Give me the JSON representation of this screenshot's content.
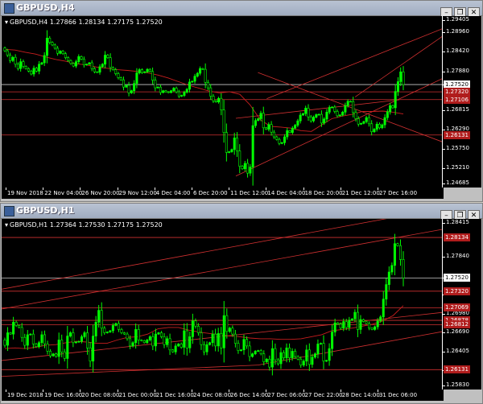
{
  "colors": {
    "background": "#000000",
    "bull_candle": "#00ff00",
    "bear_candle": "#00ff00",
    "hline_white": "#c8c8c8",
    "hline_red": "#d03030",
    "moving_average": "#c81e1e",
    "channel": "#d03030",
    "price_label_red": "#b01c1c"
  },
  "windows": [
    {
      "title": "GBPUSD,H4",
      "info": "GBPUSD,H4  1.27866 1.28134 1.27175 1.27520",
      "chart_data": {
        "type": "candlestick",
        "symbol": "GBPUSD",
        "timeframe": "H4",
        "ohlc_last": {
          "open": 1.27866,
          "high": 1.28134,
          "low": 1.27175,
          "close": 1.2752
        },
        "ylim": [
          1.24685,
          1.29405
        ],
        "price_ticks": [
          "1.29405",
          "1.28960",
          "1.28420",
          "1.27880",
          "1.27520",
          "1.26815",
          "1.26290",
          "1.25750",
          "1.25210",
          "1.24685"
        ],
        "price_labels": [
          {
            "text": "1.27520",
            "value": 1.2752,
            "style": "white"
          },
          {
            "text": "1.27320",
            "value": 1.2732,
            "style": "red"
          },
          {
            "text": "1.27106",
            "value": 1.27106,
            "style": "red"
          },
          {
            "text": "1.26131",
            "value": 1.26131,
            "style": "red"
          }
        ],
        "time_labels": [
          "19 Nov 2018",
          "22 Nov 04:00",
          "26 Nov 20:00",
          "29 Nov 12:00",
          "4 Dec 04:00",
          "6 Dec 20:00",
          "11 Dec 12:00",
          "14 Dec 04:00",
          "18 Dec 20:00",
          "21 Dec 12:00",
          "27 Dec 16:00"
        ],
        "closes": [
          1.2845,
          1.2833,
          1.2818,
          1.2827,
          1.2808,
          1.2796,
          1.2815,
          1.2802,
          1.2796,
          1.2789,
          1.2781,
          1.2797,
          1.2789,
          1.2808,
          1.2812,
          1.2832,
          1.288,
          1.2868,
          1.2861,
          1.2852,
          1.2838,
          1.2844,
          1.2837,
          1.2826,
          1.2818,
          1.281,
          1.2803,
          1.2815,
          1.2829,
          1.2822,
          1.2806,
          1.2808,
          1.2812,
          1.2796,
          1.2787,
          1.2786,
          1.2801,
          1.2808,
          1.2833,
          1.2826,
          1.2799,
          1.2793,
          1.2782,
          1.2771,
          1.2765,
          1.2745,
          1.275,
          1.2729,
          1.2735,
          1.2755,
          1.2784,
          1.2793,
          1.2785,
          1.2787,
          1.2794,
          1.2788,
          1.2764,
          1.2743,
          1.2745,
          1.273,
          1.2735,
          1.2732,
          1.273,
          1.2735,
          1.2742,
          1.2732,
          1.272,
          1.2722,
          1.2731,
          1.2739,
          1.2759,
          1.2761,
          1.2775,
          1.2783,
          1.2796,
          1.2794,
          1.2758,
          1.2743,
          1.272,
          1.2707,
          1.2704,
          1.2714,
          1.2682,
          1.262,
          1.2565,
          1.2567,
          1.2573,
          1.2605,
          1.2569,
          1.2527,
          1.252,
          1.2535,
          1.2508,
          1.2525,
          1.2639,
          1.2653,
          1.2658,
          1.2673,
          1.2633,
          1.2629,
          1.2642,
          1.2621,
          1.2608,
          1.2601,
          1.259,
          1.2592,
          1.2608,
          1.2625,
          1.262,
          1.2632,
          1.264,
          1.2652,
          1.2668,
          1.2672,
          1.2687,
          1.2663,
          1.2652,
          1.2662,
          1.2669,
          1.267,
          1.2646,
          1.2657,
          1.2676,
          1.2689,
          1.269,
          1.2678,
          1.2666,
          1.2668,
          1.2676,
          1.2694,
          1.2706,
          1.2705,
          1.2675,
          1.2658,
          1.2643,
          1.2645,
          1.265,
          1.2661,
          1.2644,
          1.2622,
          1.2629,
          1.2643,
          1.2633,
          1.2641,
          1.2661,
          1.2677,
          1.2694,
          1.2688,
          1.2733,
          1.276,
          1.2787,
          1.2752
        ]
      },
      "ma_points": [
        1.2849,
        1.2847,
        1.2841,
        1.2836,
        1.2828,
        1.2821,
        1.2816,
        1.2809,
        1.2806,
        1.28,
        1.2797,
        1.2793,
        1.2791,
        1.2788,
        1.2784,
        1.2778,
        1.277,
        1.276,
        1.275,
        1.2742,
        1.2734,
        1.2729,
        1.2732,
        1.2725,
        1.2696,
        1.2655,
        1.2637,
        1.2635,
        1.2632,
        1.2625,
        1.2623,
        1.2641,
        1.2658,
        1.2665,
        1.267,
        1.2678,
        1.2678,
        1.2679,
        1.2676,
        1.2671
      ],
      "trend_lines": [
        {
          "x1": 0.53,
          "y1": 1.2659,
          "x2": 0.9,
          "y2": 1.271
        },
        {
          "x1": 0.53,
          "y1": 1.25,
          "x2": 1.0,
          "y2": 1.277
        },
        {
          "x1": 0.58,
          "y1": 1.2785,
          "x2": 1.0,
          "y2": 1.2593
        },
        {
          "x1": 0.8,
          "y1": 1.2718,
          "x2": 1.0,
          "y2": 1.2887
        },
        {
          "x1": 0.6,
          "y1": 1.2713,
          "x2": 1.0,
          "y2": 1.2907
        }
      ]
    },
    {
      "title": "GBPUSD,H1",
      "info": "GBPUSD,H1  1.27364 1.27530 1.27175 1.27520",
      "chart_data": {
        "type": "candlestick",
        "symbol": "GBPUSD",
        "timeframe": "H1",
        "ohlc_last": {
          "open": 1.27364,
          "high": 1.2753,
          "low": 1.27175,
          "close": 1.2752
        },
        "ylim": [
          1.2583,
          1.28415
        ],
        "price_ticks": [
          "1.28415",
          "1.27840",
          "1.27520",
          "1.27265",
          "1.26980",
          "1.26690",
          "1.26405",
          "1.26120",
          "1.25830"
        ],
        "price_labels": [
          {
            "text": "1.28134",
            "value": 1.28134,
            "style": "red"
          },
          {
            "text": "1.27520",
            "value": 1.2752,
            "style": "white"
          },
          {
            "text": "1.27320",
            "value": 1.2732,
            "style": "red"
          },
          {
            "text": "1.27069",
            "value": 1.27069,
            "style": "red"
          },
          {
            "text": "1.26878",
            "value": 1.26878,
            "style": "red"
          },
          {
            "text": "1.26812",
            "value": 1.26812,
            "style": "red"
          },
          {
            "text": "1.26131",
            "value": 1.26131,
            "style": "red"
          }
        ],
        "time_labels": [
          "19 Dec 2018",
          "19 Dec 16:00",
          "20 Dec 08:00",
          "21 Dec 00:00",
          "21 Dec 16:00",
          "24 Dec 08:00",
          "26 Dec 14:00",
          "27 Dec 06:00",
          "27 Dec 22:00",
          "28 Dec 14:00",
          "31 Dec 06:00"
        ],
        "closes": [
          1.265,
          1.2669,
          1.2667,
          1.2685,
          1.268,
          1.2677,
          1.2662,
          1.265,
          1.2666,
          1.2667,
          1.2652,
          1.2648,
          1.2654,
          1.2666,
          1.2652,
          1.2641,
          1.2634,
          1.2637,
          1.2633,
          1.2658,
          1.264,
          1.263,
          1.2664,
          1.2669,
          1.2654,
          1.2655,
          1.2656,
          1.2663,
          1.2669,
          1.2646,
          1.2626,
          1.2664,
          1.2685,
          1.2703,
          1.2676,
          1.2669,
          1.267,
          1.2672,
          1.268,
          1.2683,
          1.2674,
          1.2669,
          1.2667,
          1.266,
          1.2649,
          1.2654,
          1.2674,
          1.2658,
          1.2657,
          1.2654,
          1.2658,
          1.2663,
          1.2649,
          1.2667,
          1.2669,
          1.2663,
          1.2651,
          1.266,
          1.2643,
          1.264,
          1.2649,
          1.2652,
          1.2647,
          1.2672,
          1.2646,
          1.2663,
          1.2687,
          1.2679,
          1.2669,
          1.2651,
          1.264,
          1.2651,
          1.2654,
          1.2667,
          1.2649,
          1.2668,
          1.2646,
          1.2695,
          1.2671,
          1.2676,
          1.2667,
          1.2653,
          1.2642,
          1.2643,
          1.2659,
          1.2649,
          1.2633,
          1.2637,
          1.2641,
          1.2642,
          1.2637,
          1.2625,
          1.2629,
          1.2617,
          1.2645,
          1.2628,
          1.2622,
          1.2639,
          1.2631,
          1.2646,
          1.2631,
          1.2641,
          1.2633,
          1.2629,
          1.262,
          1.2626,
          1.2643,
          1.2621,
          1.2632,
          1.2637,
          1.2652,
          1.2653,
          1.2626,
          1.2627,
          1.2645,
          1.267,
          1.2684,
          1.2682,
          1.2676,
          1.2686,
          1.2677,
          1.2688,
          1.269,
          1.27,
          1.2674,
          1.2689,
          1.2686,
          1.2683,
          1.2676,
          1.2674,
          1.2678,
          1.2687,
          1.2693,
          1.272,
          1.2742,
          1.2761,
          1.2771,
          1.2804,
          1.2801,
          1.278,
          1.2752
        ]
      },
      "ma_points": [
        1.2645,
        1.2646,
        1.2645,
        1.2647,
        1.265,
        1.2651,
        1.2654,
        1.2656,
        1.2655,
        1.2653,
        1.2653,
        1.2658,
        1.2662,
        1.2663,
        1.2667,
        1.2675,
        1.2677,
        1.2677,
        1.2673,
        1.267,
        1.2668,
        1.2666,
        1.2664,
        1.2663,
        1.2661,
        1.266,
        1.266,
        1.2659,
        1.2659,
        1.266,
        1.2663,
        1.2666,
        1.2672,
        1.2674,
        1.2676,
        1.2679,
        1.2682,
        1.2687,
        1.2695,
        1.271
      ],
      "trend_lines": [
        {
          "x1": 0.0,
          "y1": 1.2627,
          "x2": 1.0,
          "y2": 1.27
        },
        {
          "x1": 0.0,
          "y1": 1.2705,
          "x2": 1.0,
          "y2": 1.2826
        },
        {
          "x1": 0.0,
          "y1": 1.2735,
          "x2": 0.88,
          "y2": 1.2843
        },
        {
          "x1": 0.58,
          "y1": 1.262,
          "x2": 1.0,
          "y2": 1.2671
        },
        {
          "x1": 0.0,
          "y1": 1.2603,
          "x2": 0.58,
          "y2": 1.262
        }
      ]
    }
  ]
}
